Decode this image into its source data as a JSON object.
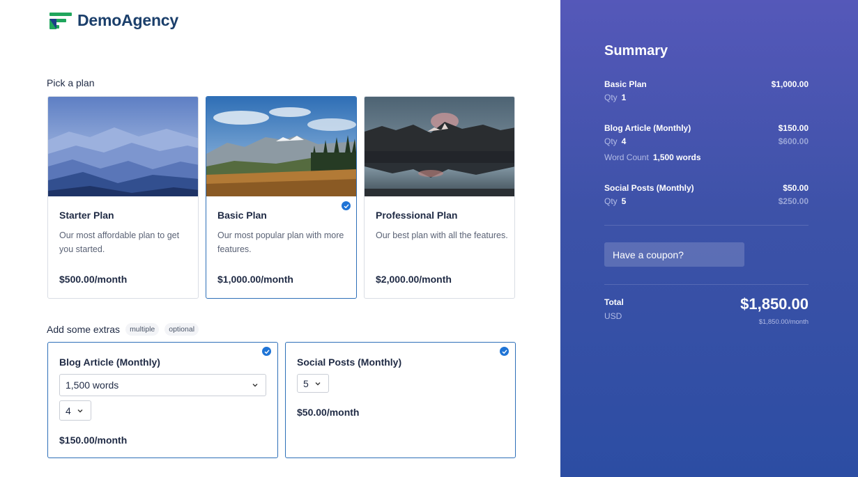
{
  "brand": {
    "name": "DemoAgency"
  },
  "plans_section": {
    "title": "Pick a plan"
  },
  "plans": [
    {
      "name": "Starter Plan",
      "description": "Our most affordable plan to get you started.",
      "price": "$500.00/month",
      "selected": false,
      "image": "misty-mountains-image"
    },
    {
      "name": "Basic Plan",
      "description": "Our most popular plan with more features.",
      "price": "$1,000.00/month",
      "selected": true,
      "image": "meadow-mountains-image"
    },
    {
      "name": "Professional Plan",
      "description": "Our best plan with all the features.",
      "price": "$2,000.00/month",
      "selected": false,
      "image": "lake-reflection-image"
    }
  ],
  "extras_section": {
    "title": "Add some extras",
    "tags": [
      "multiple",
      "optional"
    ]
  },
  "extras": [
    {
      "name": "Blog Article (Monthly)",
      "word_count": "1,500 words",
      "qty": "4",
      "price": "$150.00/month",
      "selected": true
    },
    {
      "name": "Social Posts (Monthly)",
      "qty": "5",
      "price": "$50.00/month",
      "selected": true
    }
  ],
  "summary": {
    "title": "Summary",
    "qty_label": "Qty",
    "word_count_label": "Word Count",
    "items": [
      {
        "name": "Basic Plan",
        "amount": "$1,000.00",
        "qty": "1"
      },
      {
        "name": "Blog Article (Monthly)",
        "amount": "$150.00",
        "qty": "4",
        "qty_total": "$600.00",
        "word_count": "1,500 words"
      },
      {
        "name": "Social Posts (Monthly)",
        "amount": "$50.00",
        "qty": "5",
        "qty_total": "$250.00"
      }
    ],
    "coupon_label": "Have a coupon?",
    "total_label": "Total",
    "currency": "USD",
    "total": "$1,850.00",
    "total_sub": "$1,850.00/month"
  },
  "colors": {
    "accent": "#1f74d6",
    "brand_green": "#1fa55c",
    "brand_navy": "#1b3f6b",
    "summary_bg": "#3d52a8"
  }
}
